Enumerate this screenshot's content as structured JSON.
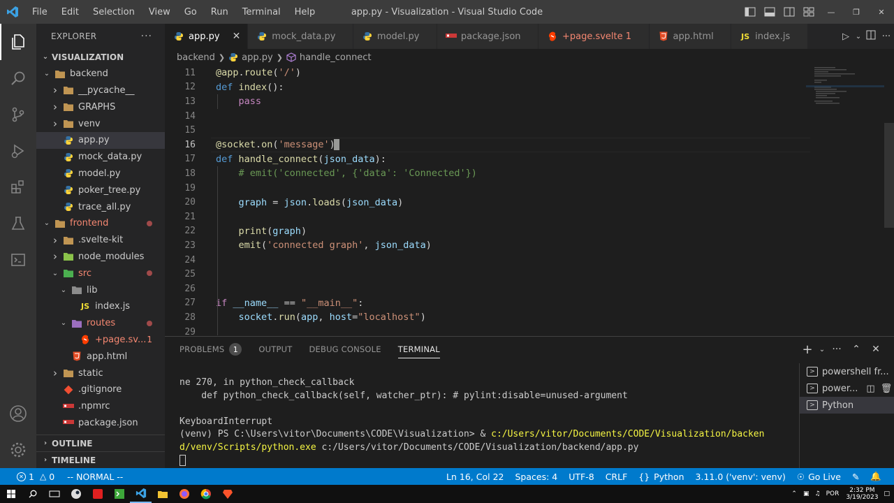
{
  "app": {
    "window_title": "app.py - Visualization - Visual Studio Code",
    "menu": [
      "File",
      "Edit",
      "Selection",
      "View",
      "Go",
      "Run",
      "Terminal",
      "Help"
    ]
  },
  "sidebar": {
    "header": "EXPLORER",
    "more": "···",
    "project": "VISUALIZATION",
    "outline": "OUTLINE",
    "timeline": "TIMELINE",
    "tree": [
      {
        "label": "backend",
        "type": "folder",
        "open": true,
        "depth": 1
      },
      {
        "label": "__pycache__",
        "type": "folder",
        "open": false,
        "depth": 2
      },
      {
        "label": "GRAPHS",
        "type": "folder",
        "open": false,
        "depth": 2
      },
      {
        "label": "venv",
        "type": "folder",
        "open": false,
        "depth": 2
      },
      {
        "label": "app.py",
        "type": "py",
        "depth": 2,
        "selected": true
      },
      {
        "label": "mock_data.py",
        "type": "py",
        "depth": 2
      },
      {
        "label": "model.py",
        "type": "py",
        "depth": 2
      },
      {
        "label": "poker_tree.py",
        "type": "py",
        "depth": 2
      },
      {
        "label": "trace_all.py",
        "type": "py",
        "depth": 2
      },
      {
        "label": "frontend",
        "type": "folder",
        "open": true,
        "depth": 1,
        "error": true,
        "dot": true
      },
      {
        "label": ".svelte-kit",
        "type": "folder",
        "open": false,
        "depth": 2
      },
      {
        "label": "node_modules",
        "type": "node",
        "open": false,
        "depth": 2
      },
      {
        "label": "src",
        "type": "src",
        "open": true,
        "depth": 2,
        "error": true,
        "dot": true
      },
      {
        "label": "lib",
        "type": "lib",
        "open": true,
        "depth": 3
      },
      {
        "label": "index.js",
        "type": "js",
        "depth": 4
      },
      {
        "label": "routes",
        "type": "routes",
        "open": true,
        "depth": 3,
        "error": true,
        "dot": true
      },
      {
        "label": "+page.sv...",
        "type": "svelte",
        "depth": 4,
        "error": true,
        "count": "1"
      },
      {
        "label": "app.html",
        "type": "html",
        "depth": 3
      },
      {
        "label": "static",
        "type": "folder",
        "open": false,
        "depth": 2
      },
      {
        "label": ".gitignore",
        "type": "git",
        "depth": 2
      },
      {
        "label": ".npmrc",
        "type": "npmrc",
        "depth": 2
      },
      {
        "label": "package.json",
        "type": "json",
        "depth": 2
      }
    ]
  },
  "tabs": [
    {
      "label": "app.py",
      "type": "py",
      "active": true
    },
    {
      "label": "mock_data.py",
      "type": "py"
    },
    {
      "label": "model.py",
      "type": "py"
    },
    {
      "label": "package.json",
      "type": "json"
    },
    {
      "label": "+page.svelte 1",
      "type": "svelte",
      "error": true
    },
    {
      "label": "app.html",
      "type": "html"
    },
    {
      "label": "index.js",
      "type": "js"
    }
  ],
  "breadcrumb": [
    "backend",
    "app.py",
    "handle_connect"
  ],
  "editor": {
    "current_line": 16,
    "lines": [
      {
        "n": "11",
        "code": "@app.route('/')"
      },
      {
        "n": "12",
        "code": "def index():"
      },
      {
        "n": "13",
        "code": "    pass"
      },
      {
        "n": "14",
        "code": ""
      },
      {
        "n": "15",
        "code": ""
      },
      {
        "n": "16",
        "code": "@socket.on('message')"
      },
      {
        "n": "17",
        "code": "def handle_connect(json_data):"
      },
      {
        "n": "18",
        "code": "    # emit('connected', {'data': 'Connected'})"
      },
      {
        "n": "19",
        "code": ""
      },
      {
        "n": "20",
        "code": "    graph = json.loads(json_data)"
      },
      {
        "n": "21",
        "code": ""
      },
      {
        "n": "22",
        "code": "    print(graph)"
      },
      {
        "n": "23",
        "code": "    emit('connected graph', json_data)"
      },
      {
        "n": "24",
        "code": ""
      },
      {
        "n": "25",
        "code": ""
      },
      {
        "n": "26",
        "code": ""
      },
      {
        "n": "27",
        "code": "if __name__ == \"__main__\":"
      },
      {
        "n": "28",
        "code": "    socket.run(app, host=\"localhost\")"
      },
      {
        "n": "29",
        "code": ""
      }
    ]
  },
  "panel": {
    "tabs": {
      "problems": "PROBLEMS",
      "problems_count": "1",
      "output": "OUTPUT",
      "debug": "DEBUG CONSOLE",
      "terminal": "TERMINAL"
    },
    "terminal_lines": [
      "ne 270, in python_check_callback",
      "    def python_check_callback(self, watcher_ptr): # pylint:disable=unused-argument",
      "",
      "KeyboardInterrupt",
      "(venv) PS C:\\Users\\vitor\\Documents\\CODE\\Visualization> & ",
      "d/venv/Scripts/python.exe",
      ""
    ],
    "term_prompt_path": "c:/Users/vitor/Documents/CODE/Visualization/backen",
    "term_line6_rest": " c:/Users/vitor/Documents/CODE/Visualization/backend/app.py",
    "terminals": [
      "powershell fr...",
      "power...",
      "Python"
    ]
  },
  "statusbar": {
    "errors": "1",
    "warnings": "0",
    "mode": "-- NORMAL --",
    "position": "Ln 16, Col 22",
    "spaces": "Spaces: 4",
    "encoding": "UTF-8",
    "eol": "CRLF",
    "language": "Python",
    "interpreter": "3.11.0 ('venv': venv)",
    "golive": "Go Live"
  },
  "taskbar": {
    "lang": "POR",
    "time": "2:32 PM",
    "date": "3/19/2023"
  },
  "colors": {
    "accent": "#007acc",
    "python_blue": "#3572a5",
    "python_yellow": "#ffd43b",
    "error": "#f48771"
  }
}
